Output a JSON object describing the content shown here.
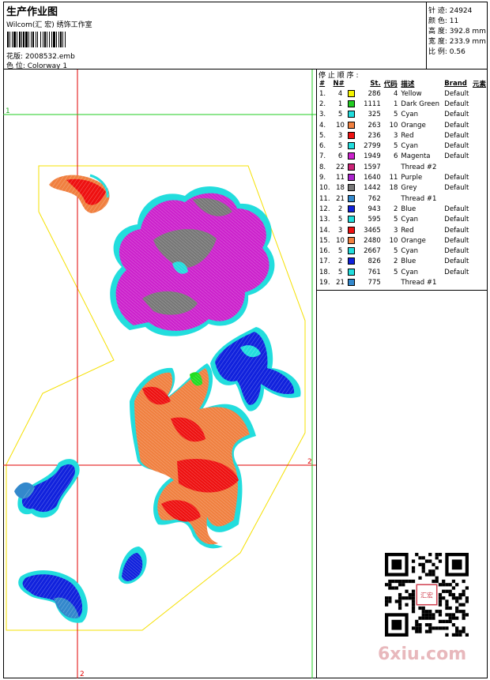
{
  "header": {
    "title": "生产作业图",
    "subtitle": "Wilcom(汇 宏) 绣饰工作室",
    "pattern_label": "花版: 2008532.emb",
    "colorway_label": "色 位:  Colorway 1"
  },
  "stats": {
    "stitches": "针 迹:  24924",
    "colors": "颜 色:  11",
    "height": "高 度:  392.8 mm",
    "width": "宽 度:  233.9 mm",
    "scale": "比 例:  0.56"
  },
  "stop_sequence": {
    "heading": "停 止 顺 序 :",
    "columns": [
      "#",
      "N#",
      "St.",
      "代码",
      "描述",
      "Brand",
      "元素"
    ],
    "rows": [
      {
        "idx": "1.",
        "n": "4",
        "color": "#f5f500",
        "st": "286",
        "code": "4",
        "desc": "Yellow",
        "brand": "Default"
      },
      {
        "idx": "2.",
        "n": "1",
        "color": "#22cc22",
        "st": "1111",
        "code": "1",
        "desc": "Dark Green",
        "brand": "Default"
      },
      {
        "idx": "3.",
        "n": "5",
        "color": "#22dddd",
        "st": "325",
        "code": "5",
        "desc": "Cyan",
        "brand": "Default"
      },
      {
        "idx": "4.",
        "n": "10",
        "color": "#f08040",
        "st": "263",
        "code": "10",
        "desc": "Orange",
        "brand": "Default"
      },
      {
        "idx": "5.",
        "n": "3",
        "color": "#ee1111",
        "st": "236",
        "code": "3",
        "desc": "Red",
        "brand": "Default"
      },
      {
        "idx": "6.",
        "n": "5",
        "color": "#22dddd",
        "st": "2799",
        "code": "5",
        "desc": "Cyan",
        "brand": "Default"
      },
      {
        "idx": "7.",
        "n": "6",
        "color": "#cc22cc",
        "st": "1949",
        "code": "6",
        "desc": "Magenta",
        "brand": "Default"
      },
      {
        "idx": "8.",
        "n": "22",
        "color": "#cc2277",
        "st": "1597",
        "code": "",
        "desc": "Thread #2",
        "brand": ""
      },
      {
        "idx": "9.",
        "n": "11",
        "color": "#aa22cc",
        "st": "1640",
        "code": "11",
        "desc": "Purple",
        "brand": "Default"
      },
      {
        "idx": "10.",
        "n": "18",
        "color": "#777777",
        "st": "1442",
        "code": "18",
        "desc": "Grey",
        "brand": "Default"
      },
      {
        "idx": "11.",
        "n": "21",
        "color": "#3388cc",
        "st": "762",
        "code": "",
        "desc": "Thread #1",
        "brand": ""
      },
      {
        "idx": "12.",
        "n": "2",
        "color": "#1122dd",
        "st": "943",
        "code": "2",
        "desc": "Blue",
        "brand": "Default"
      },
      {
        "idx": "13.",
        "n": "5",
        "color": "#22dddd",
        "st": "595",
        "code": "5",
        "desc": "Cyan",
        "brand": "Default"
      },
      {
        "idx": "14.",
        "n": "3",
        "color": "#ee1111",
        "st": "3465",
        "code": "3",
        "desc": "Red",
        "brand": "Default"
      },
      {
        "idx": "15.",
        "n": "10",
        "color": "#f08040",
        "st": "2480",
        "code": "10",
        "desc": "Orange",
        "brand": "Default"
      },
      {
        "idx": "16.",
        "n": "5",
        "color": "#22dddd",
        "st": "2667",
        "code": "5",
        "desc": "Cyan",
        "brand": "Default"
      },
      {
        "idx": "17.",
        "n": "2",
        "color": "#1122dd",
        "st": "826",
        "code": "2",
        "desc": "Blue",
        "brand": "Default"
      },
      {
        "idx": "18.",
        "n": "5",
        "color": "#22dddd",
        "st": "761",
        "code": "5",
        "desc": "Cyan",
        "brand": "Default"
      },
      {
        "idx": "19.",
        "n": "21",
        "color": "#3388cc",
        "st": "775",
        "code": "",
        "desc": "Thread #1",
        "brand": ""
      }
    ]
  },
  "guides": {
    "marker_1": "1",
    "marker_2_right": "2",
    "marker_2_bottom": "2"
  },
  "watermark": "6xiu.com",
  "qr_seal_text": "汇宏"
}
